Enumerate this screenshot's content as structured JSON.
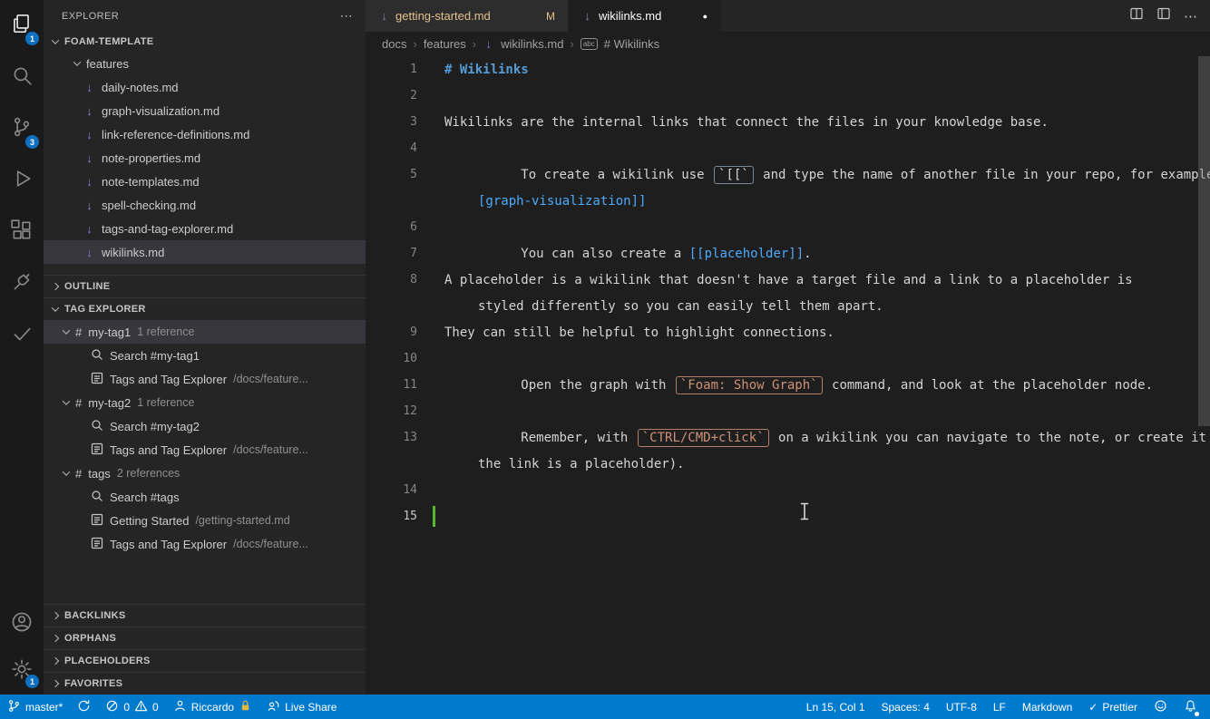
{
  "colors": {
    "accent": "#007acc",
    "activity_bg": "#1a1a1a",
    "sidebar_bg": "#252526",
    "editor_bg": "#1e1e1e",
    "tabbar_bg": "#252526",
    "tab_inactive_bg": "#2d2d2d",
    "selection_bg": "#37373d",
    "text": "#d4d4d4",
    "dim_text": "#8f8f8f",
    "heading": "#569cd6",
    "link": "#4daafc",
    "code_orange": "#ce9178",
    "modified": "#e2c08d",
    "badge_bg": "#0e70c0",
    "git_added": "#5bb530",
    "md_icon": "#9178c8",
    "border": "#333333"
  },
  "icons": {
    "markdown_file": "↓",
    "tag": "#",
    "more": "⋯",
    "chevron_sep": "›",
    "check": "✓",
    "symbol_abc": "abc"
  },
  "activity_bar": {
    "explorer_badge": "1",
    "source_control_badge": "3",
    "settings_badge": "1"
  },
  "sidebar": {
    "title": "EXPLORER",
    "project": "FOAM-TEMPLATE",
    "folder": "features",
    "files": [
      "daily-notes.md",
      "graph-visualization.md",
      "link-reference-definitions.md",
      "note-properties.md",
      "note-templates.md",
      "spell-checking.md",
      "tags-and-tag-explorer.md",
      "wikilinks.md"
    ],
    "outline": "OUTLINE",
    "tag_explorer": "TAG EXPLORER",
    "tag_rows": [
      {
        "label": "my-tag1",
        "detail": "1 reference"
      },
      {
        "label": "Search #my-tag1"
      },
      {
        "label": "Tags and Tag Explorer",
        "detail": "/docs/feature..."
      },
      {
        "label": "my-tag2",
        "detail": "1 reference"
      },
      {
        "label": "Search #my-tag2"
      },
      {
        "label": "Tags and Tag Explorer",
        "detail": "/docs/feature..."
      },
      {
        "label": "tags",
        "detail": "2 references"
      },
      {
        "label": "Search #tags"
      },
      {
        "label": "Getting Started",
        "detail": "/getting-started.md"
      },
      {
        "label": "Tags and Tag Explorer",
        "detail": "/docs/feature..."
      }
    ],
    "sections": [
      "BACKLINKS",
      "ORPHANS",
      "PLACEHOLDERS",
      "FAVORITES"
    ]
  },
  "tabs": {
    "tab1": {
      "label": "getting-started.md",
      "badge": "M"
    },
    "tab2": {
      "label": "wikilinks.md",
      "badge": "●"
    }
  },
  "breadcrumbs": {
    "items": [
      "docs",
      "features",
      "wikilinks.md",
      "# Wikilinks"
    ]
  },
  "editor": {
    "lines": [
      {
        "num": "1",
        "parts": [
          {
            "t": "# Wikilinks"
          }
        ]
      },
      {
        "num": "2",
        "parts": []
      },
      {
        "num": "3",
        "parts": [
          {
            "t": "Wikilinks are the internal links that connect the files in your knowledge base."
          }
        ]
      },
      {
        "num": "4",
        "parts": []
      },
      {
        "num": "5",
        "parts": [
          {
            "t": "To create a wikilink use "
          },
          {
            "t": "`[[`"
          },
          {
            "t": " and type the name of another file in your repo, for example "
          },
          {
            "t": "["
          }
        ]
      },
      {
        "num": "",
        "parts": [
          {
            "t": "[graph-visualization]]"
          }
        ]
      },
      {
        "num": "6",
        "parts": []
      },
      {
        "num": "7",
        "parts": [
          {
            "t": "You can also create a "
          },
          {
            "t": "[[placeholder]]"
          },
          {
            "t": "."
          }
        ]
      },
      {
        "num": "8",
        "parts": [
          {
            "t": "A placeholder is a wikilink that doesn't have a target file and a link to a placeholder is"
          }
        ]
      },
      {
        "num": "",
        "parts": [
          {
            "t": "styled differently so you can easily tell them apart."
          }
        ]
      },
      {
        "num": "9",
        "parts": [
          {
            "t": "They can still be helpful to highlight connections."
          }
        ]
      },
      {
        "num": "10",
        "parts": []
      },
      {
        "num": "11",
        "parts": [
          {
            "t": "Open the graph with "
          },
          {
            "t": "`Foam: Show Graph`"
          },
          {
            "t": " command, and look at the placeholder node."
          }
        ]
      },
      {
        "num": "12",
        "parts": []
      },
      {
        "num": "13",
        "parts": [
          {
            "t": "Remember, with "
          },
          {
            "t": "`CTRL/CMD+click`"
          },
          {
            "t": " on a wikilink you can navigate to the note, or create it (if"
          }
        ]
      },
      {
        "num": "",
        "parts": [
          {
            "t": "the link is a placeholder)."
          }
        ]
      },
      {
        "num": "14",
        "parts": []
      },
      {
        "num": "15",
        "parts": []
      }
    ]
  },
  "status_bar": {
    "branch": "master*",
    "errors": "0",
    "warnings": "0",
    "user": "Riccardo",
    "live_share": "Live Share",
    "position": "Ln 15, Col 1",
    "indent": "Spaces: 4",
    "encoding": "UTF-8",
    "eol": "LF",
    "language": "Markdown",
    "formatter": "Prettier"
  }
}
